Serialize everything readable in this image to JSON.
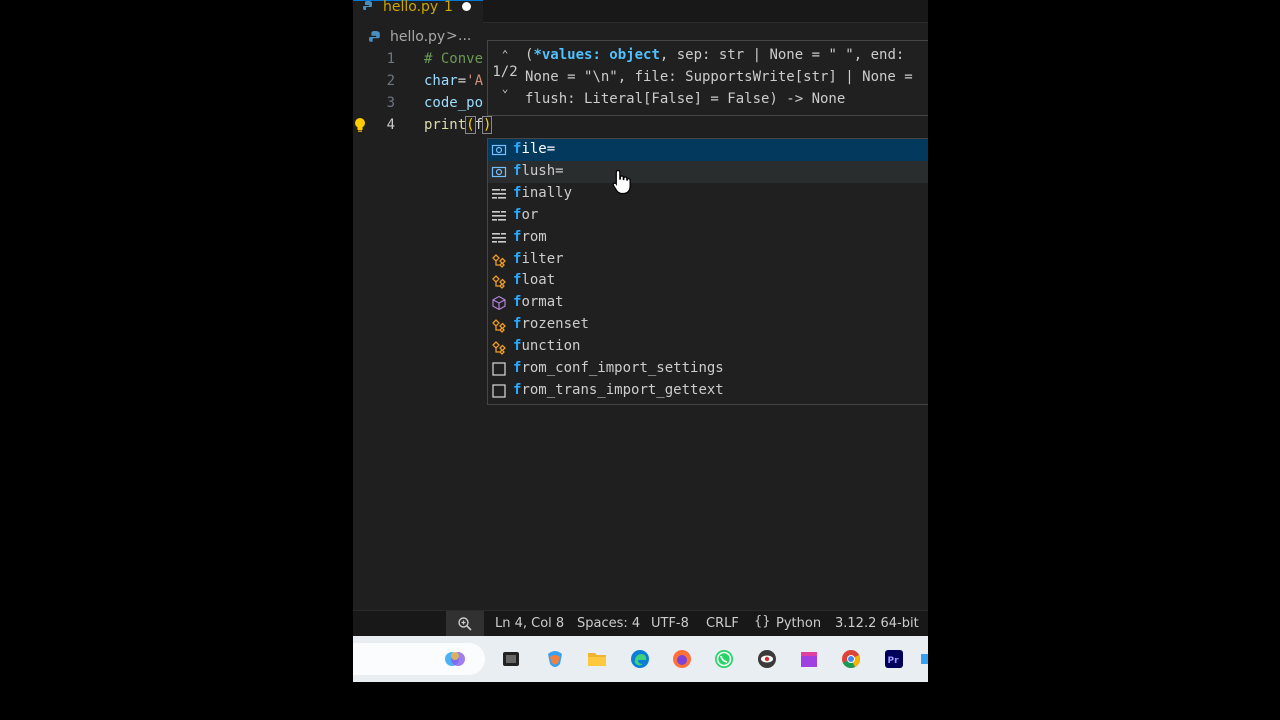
{
  "tab": {
    "filename": "hello.py",
    "problem_count": "1"
  },
  "breadcrumb": {
    "file": "hello.py",
    "separator": ">",
    "more": "..."
  },
  "editor": {
    "line_numbers": [
      "1",
      "2",
      "3",
      "4"
    ],
    "lines": [
      {
        "comment": "# Conve"
      },
      {
        "var": "char",
        "op": "=",
        "str": "'A"
      },
      {
        "var": "code_po"
      },
      {
        "fn": "print",
        "open": "(",
        "arg": "f",
        "close": ")"
      }
    ]
  },
  "signature_help": {
    "overload": "1/2",
    "open": "(",
    "active_param": "*values: object",
    "line1_rest": ", sep: str | None = \" \", end:",
    "line2": "None = \"\\n\", file: SupportsWrite[str] | None =",
    "line3": "flush: Literal[False] = False) -> None"
  },
  "suggestions": [
    {
      "match": "f",
      "rest": "ile=",
      "kind": "variable-icon",
      "state": "selected"
    },
    {
      "match": "f",
      "rest": "lush=",
      "kind": "variable-icon",
      "state": "hover"
    },
    {
      "match": "f",
      "rest": "inally",
      "kind": "keyword-icon"
    },
    {
      "match": "f",
      "rest": "or",
      "kind": "keyword-icon"
    },
    {
      "match": "f",
      "rest": "rom",
      "kind": "keyword-icon"
    },
    {
      "match": "f",
      "rest": "ilter",
      "kind": "class-icon"
    },
    {
      "match": "f",
      "rest": "loat",
      "kind": "class-icon"
    },
    {
      "match": "f",
      "rest": "ormat",
      "kind": "method-icon"
    },
    {
      "match": "f",
      "rest": "rozenset",
      "kind": "class-icon"
    },
    {
      "match": "f",
      "rest": "unction",
      "kind": "class-icon"
    },
    {
      "match": "f",
      "rest": "rom_conf_import_settings",
      "kind": "module-icon"
    },
    {
      "match": "f",
      "rest": "rom_trans_import_gettext",
      "kind": "module-icon"
    }
  ],
  "status_bar": {
    "position": "Ln 4, Col 8",
    "spaces": "Spaces: 4",
    "encoding": "UTF-8",
    "eol": "CRLF",
    "language_icon": "{}",
    "language": "Python",
    "interpreter": "3.12.2 64-bit"
  },
  "colors": {
    "editor_bg": "#1f1f1f",
    "selection": "#04395e",
    "match_highlight": "#2aaaff",
    "warning": "#cca700"
  }
}
